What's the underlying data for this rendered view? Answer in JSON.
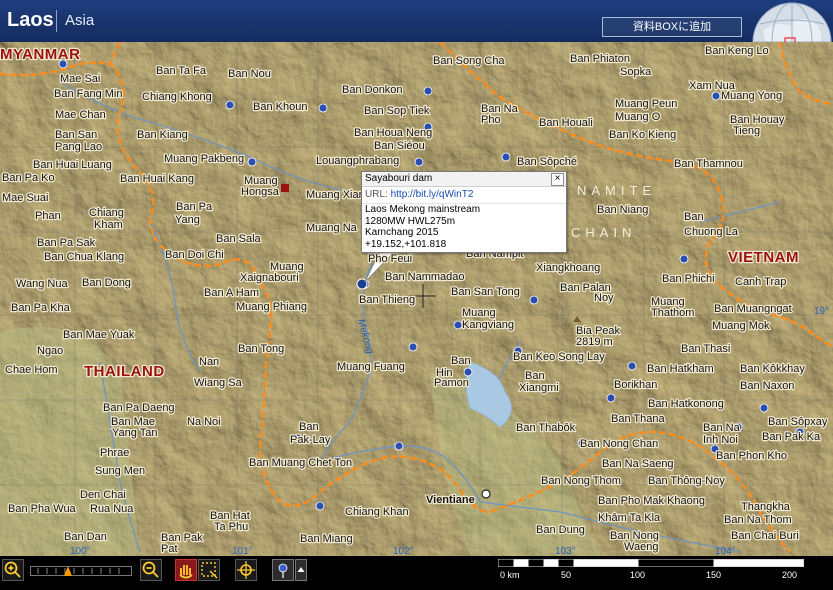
{
  "header": {
    "region_title": "Laos",
    "region_sub": "Asia",
    "add_button": "資料BOXに追加"
  },
  "map": {
    "countries": [
      {
        "name": "MYANMAR"
      },
      {
        "name": "THAILAND"
      },
      {
        "name": "VIETNAM"
      }
    ],
    "regions": [
      "NAMITE",
      "CHAIN"
    ],
    "places": [
      "Mae Sai",
      "Ban Fang Min",
      "Mae Chan",
      "Ban San",
      "Pang Lao",
      "Ban Huai Luang",
      "Ban Pa Ko",
      "Mae Suai",
      "Phan",
      "Ban Pa Sak",
      "Ban Chua Klang",
      "Wang Nua",
      "Ban Pa Kha",
      "Ngao",
      "Chae Hom",
      "Ban Mae Yuak",
      "Ban Ta Fa",
      "Ban Nou",
      "Chiang Khong",
      "Ban Kiang",
      "Ban Huai Kang",
      "Ban Pa",
      "Yang",
      "Chiang",
      "Kham",
      "Ban Dong",
      "Ban Doi Chi",
      "Ban Sala",
      "Muang",
      "Xaignabouri",
      "Ban A Ham",
      "Muang Phiang",
      "Ban Tong",
      "Nan",
      "Wiang Sa",
      "Na Noi",
      "Ban Pa Daeng",
      "Ban Mae",
      "Yang Tan",
      "Phrae",
      "Sung Men",
      "Den Chai",
      "Ban Pha Wua",
      "Rua Nua",
      "Ban Khoun",
      "Ban Donkon",
      "Muang Pakbeng",
      "Muang",
      "Hongsa",
      "Muang Xian",
      "Muang Na",
      "Louangphrabang",
      "Ban Siéou",
      "Ban Houa Neng",
      "Ban Sop Tiek",
      "Ban Song Cha",
      "Ban Na",
      "Pho",
      "Ban Houali",
      "Ban Sôpché",
      "Ban Phiaton",
      "Sopka",
      "Ban Keng Lo",
      "Xam Nua",
      "Muang Yong",
      "Muang Peun",
      "Muang O",
      "Ban Houay",
      "Tieng",
      "Ban Ko Kieng",
      "Ban Thamnou",
      "Ban Niang",
      "Ban",
      "Chuong La",
      "Ban Phichi",
      "Canh Trap",
      "Ban Muangngat",
      "Muang Mok",
      "Ban Thasi",
      "Ban Kôkkhay",
      "Ban Naxon",
      "Ban Sôpxay",
      "Ban Pak Ka",
      "Ban Na",
      "Inh Noi",
      "Ban Phon Kho",
      "Pho Feui",
      "Ban Nammadao",
      "Ban Nampit",
      "Xiangkhoang",
      "Ban Thieng",
      "Ban San Tong",
      "Ban Palan",
      "Noy",
      "Muang",
      "Thathom",
      "Muang",
      "Kangviang",
      "Ban Keo Song Lay",
      "Bia Peak",
      "2819 m",
      "Muang Fuang",
      "Ban",
      "Hin",
      "Pamon",
      "Ban",
      "Xiangmi",
      "Borikhan",
      "Ban Hatkham",
      "Ban Hatkonong",
      "Ban Thabôk",
      "Ban Thana",
      "Ban Nong Chan",
      "Ban Na Saeng",
      "Ban Nong Thom",
      "Ban Thông-Noy",
      "Ban Pho Mak Khaong",
      "Khâm Ta Kla",
      "Ban Nong",
      "Waeng",
      "Thangkha",
      "Ban Na Thom",
      "Ban Chai Buri",
      "Ban Dung",
      "Vientiane",
      "Ban Muang Chet Ton",
      "Ban",
      "Pak-Lay",
      "Chiang Khan",
      "Ban Hat",
      "Ta Phu",
      "Ban Dan",
      "Ban Pak",
      "Pat",
      "Ban Miang"
    ],
    "latitudes": [
      "100°",
      "101°",
      "102°",
      "103°",
      "104°",
      "19°"
    ],
    "river_labels": [
      "Mekong"
    ]
  },
  "popup": {
    "title": "Sayabouri dam",
    "url_label": "URL:",
    "url_value": "http://bit.ly/qWinT2",
    "lines": [
      "Laos Mekong mainstream",
      "1280MW HWL275m",
      "Karnchang 2015",
      "+19.152,+101.818"
    ],
    "close": "×"
  },
  "scale_bar": {
    "labels": [
      "0 km",
      "50",
      "100",
      "150",
      "200"
    ]
  },
  "colors": {
    "header_bg": "#1f3e7e",
    "border_orange": "#ff8c1a",
    "country_red": "#9b1111",
    "terrain": "#cdbb83",
    "lake": "#a9c8e3",
    "marker_blue": "#2a4fb0"
  }
}
